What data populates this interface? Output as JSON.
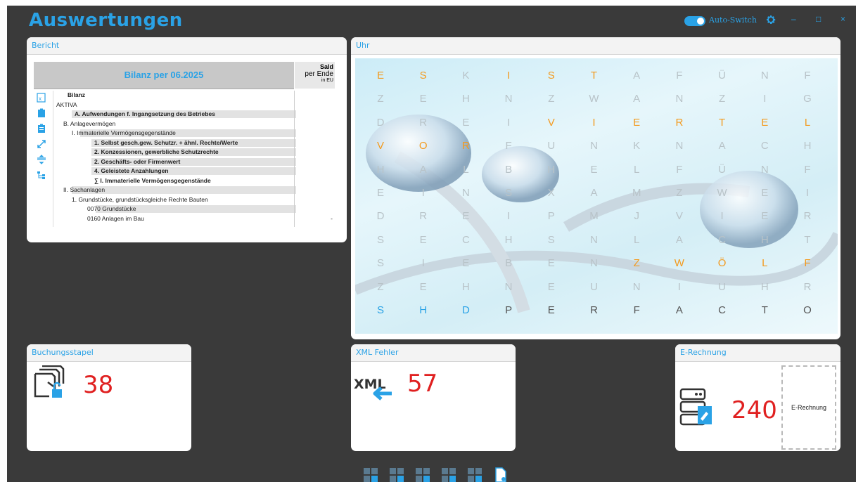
{
  "app": {
    "title": "Auswertungen",
    "auto_switch_label": "Auto-Switch",
    "auto_switch_on": true,
    "minimize": "–",
    "maximize": "□",
    "close": "×",
    "accent_color": "#2aa2e6"
  },
  "bericht": {
    "title": "Bericht",
    "report_title": "Bilanz per 06.2025",
    "col_head_1": "Sald",
    "col_head_2": "per Ende",
    "col_head_3": "in EU",
    "tools": [
      "excel-export-icon",
      "clipboard-icon",
      "clipboard-list-icon",
      "expand-icon",
      "collapse-rows-icon",
      "tree-icon"
    ],
    "rows": [
      {
        "text": "Bilanz",
        "bold": true,
        "value": ""
      },
      {
        "text": "AKTIVA",
        "bold": false,
        "value": ""
      },
      {
        "text": "A. Aufwendungen f. Ingangsetzung des Betriebes",
        "bold": true,
        "value": ""
      },
      {
        "text": "B. Anlagevermögen",
        "bold": false,
        "value": ""
      },
      {
        "text": "I. Immaterielle Vermögensgegenstände",
        "bold": false,
        "value": ""
      },
      {
        "text": "1. Selbst gesch.gew. Schutzr. + ähnl. Rechte/Werte",
        "bold": true,
        "value": ""
      },
      {
        "text": "2. Konzessionen, gewerbliche Schutzrechte",
        "bold": true,
        "value": ""
      },
      {
        "text": "2. Geschäfts- oder Firmenwert",
        "bold": true,
        "value": ""
      },
      {
        "text": "4. Geleistete Anzahlungen",
        "bold": true,
        "value": ""
      },
      {
        "text": "∑ I. Immaterielle Vermögensgegenstände",
        "bold": true,
        "value": ""
      },
      {
        "text": "II. Sachanlagen",
        "bold": false,
        "value": ""
      },
      {
        "text": "1. Grundstücke, grundstücksgleiche Rechte  Bauten",
        "bold": false,
        "value": ""
      },
      {
        "text": "0070 Grundstücke",
        "bold": false,
        "value": ""
      },
      {
        "text": "0160 Anlagen im Bau",
        "bold": false,
        "value": "-"
      }
    ]
  },
  "uhr": {
    "title": "Uhr",
    "grid": [
      [
        "E",
        "S",
        "K",
        "I",
        "S",
        "T",
        "A",
        "F",
        "Ü",
        "N",
        "F"
      ],
      [
        "Z",
        "E",
        "H",
        "N",
        "Z",
        "W",
        "A",
        "N",
        "Z",
        "I",
        "G"
      ],
      [
        "D",
        "R",
        "E",
        "I",
        "V",
        "I",
        "E",
        "R",
        "T",
        "E",
        "L"
      ],
      [
        "V",
        "O",
        "R",
        "F",
        "U",
        "N",
        "K",
        "N",
        "A",
        "C",
        "H"
      ],
      [
        "H",
        "A",
        "L",
        "B",
        "H",
        "E",
        "L",
        "F",
        "Ü",
        "N",
        "F"
      ],
      [
        "E",
        "I",
        "N",
        "S",
        "X",
        "A",
        "M",
        "Z",
        "W",
        "E",
        "I"
      ],
      [
        "D",
        "R",
        "E",
        "I",
        "P",
        "M",
        "J",
        "V",
        "I",
        "E",
        "R"
      ],
      [
        "S",
        "E",
        "C",
        "H",
        "S",
        "N",
        "L",
        "A",
        "C",
        "H",
        "T"
      ],
      [
        "S",
        "I",
        "E",
        "B",
        "E",
        "N",
        "Z",
        "W",
        "Ö",
        "L",
        "F"
      ],
      [
        "Z",
        "E",
        "H",
        "N",
        "E",
        "U",
        "N",
        "I",
        "U",
        "H",
        "R"
      ],
      [
        "S",
        "H",
        "D",
        "P",
        "E",
        "R",
        "F",
        "A",
        "C",
        "T",
        "O"
      ]
    ],
    "highlight": [
      [
        0,
        0
      ],
      [
        0,
        1
      ],
      [
        0,
        3
      ],
      [
        0,
        4
      ],
      [
        0,
        5
      ],
      [
        2,
        4
      ],
      [
        2,
        5
      ],
      [
        2,
        6
      ],
      [
        2,
        7
      ],
      [
        2,
        8
      ],
      [
        2,
        9
      ],
      [
        2,
        10
      ],
      [
        3,
        0
      ],
      [
        3,
        1
      ],
      [
        3,
        2
      ],
      [
        8,
        6
      ],
      [
        8,
        7
      ],
      [
        8,
        8
      ],
      [
        8,
        9
      ],
      [
        8,
        10
      ]
    ],
    "highlight_color": "#f39a1e",
    "brand_blue_cells": [
      [
        10,
        0
      ],
      [
        10,
        1
      ],
      [
        10,
        2
      ]
    ],
    "brand_dark_cells": [
      [
        10,
        3
      ],
      [
        10,
        4
      ],
      [
        10,
        5
      ],
      [
        10,
        6
      ],
      [
        10,
        7
      ],
      [
        10,
        8
      ],
      [
        10,
        9
      ],
      [
        10,
        10
      ]
    ]
  },
  "buchungsstapel": {
    "title": "Buchungsstapel",
    "count": "38"
  },
  "xml_fehler": {
    "title": "XML Fehler",
    "count": "57",
    "icon_label": "XML"
  },
  "erechnung": {
    "title": "E-Rechnung",
    "count": "240",
    "button_label": "E-Rechnung"
  },
  "count_color": "#e02020",
  "page_switcher": [
    "layout-1-icon",
    "layout-2-icon",
    "layout-3-icon",
    "layout-4-icon",
    "layout-5-icon",
    "new-document-icon"
  ]
}
